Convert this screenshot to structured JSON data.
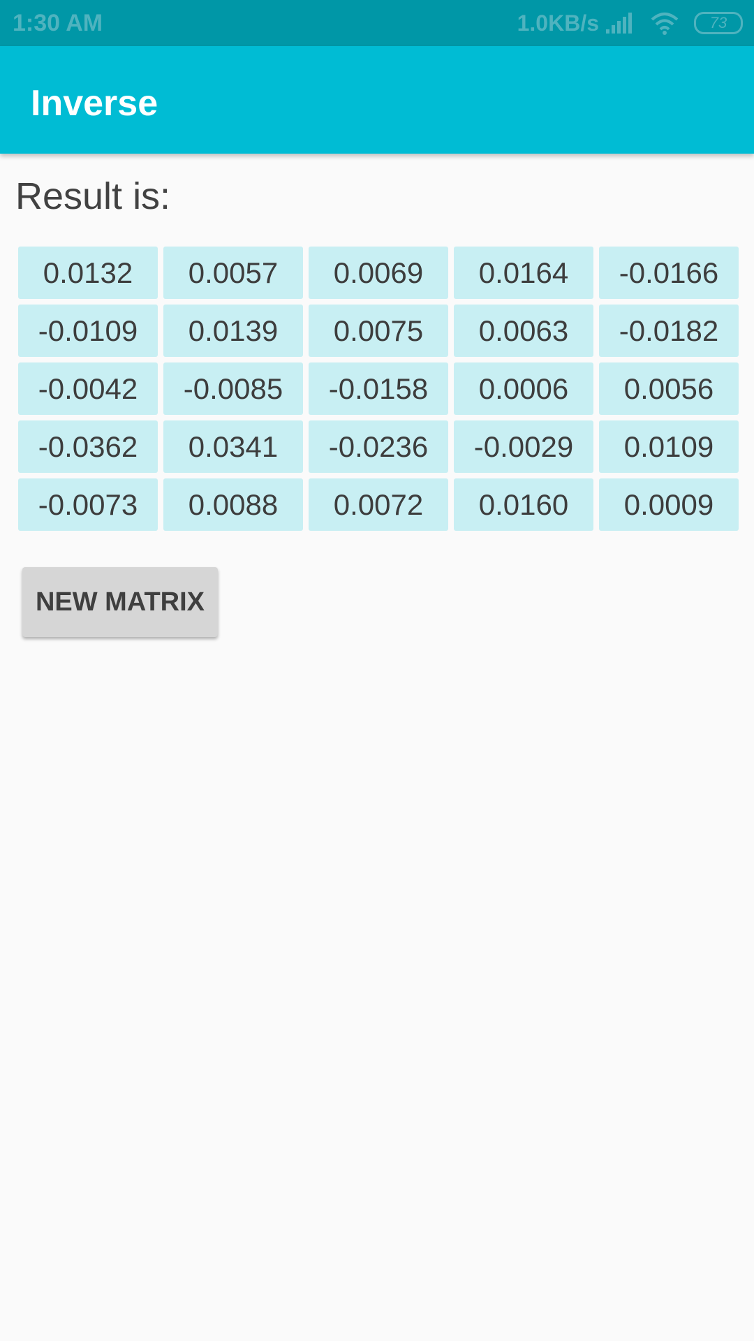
{
  "status_bar": {
    "time": "1:30 AM",
    "net_speed": "1.0KB/s",
    "battery": "73",
    "icons": [
      "signal-icon",
      "wifi-icon",
      "battery-icon"
    ]
  },
  "app_bar": {
    "title": "Inverse",
    "color": "#00bcd4"
  },
  "content": {
    "result_label": "Result is:",
    "matrix": [
      [
        "0.0132",
        "0.0057",
        "0.0069",
        "0.0164",
        "-0.0166"
      ],
      [
        "-0.0109",
        "0.0139",
        "0.0075",
        "0.0063",
        "-0.0182"
      ],
      [
        "-0.0042",
        "-0.0085",
        "-0.0158",
        "0.0006",
        "0.0056"
      ],
      [
        "-0.0362",
        "0.0341",
        "-0.0236",
        "-0.0029",
        "0.0109"
      ],
      [
        "-0.0073",
        "0.0088",
        "0.0072",
        "0.0160",
        "0.0009"
      ]
    ],
    "new_matrix_button": "NEW MATRIX"
  }
}
